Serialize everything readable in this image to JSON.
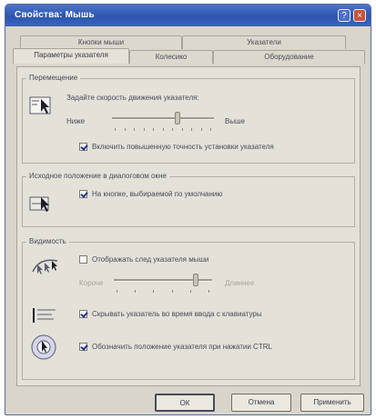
{
  "window": {
    "title": "Свойства: Мышь",
    "help_label": "?",
    "close_label": "×"
  },
  "tabs": {
    "row1": [
      {
        "label": "Кнопки мыши"
      },
      {
        "label": "Указатели"
      }
    ],
    "row2": [
      {
        "label": "Параметры указателя",
        "active": true
      },
      {
        "label": "Колесико"
      },
      {
        "label": "Оборудование"
      }
    ]
  },
  "motion": {
    "title": "Перемещение",
    "prompt": "Задайте скорость движения указателя:",
    "low_label": "Ниже",
    "high_label": "Выше",
    "speed_level": 0.65,
    "precision_label": "Включить повышенную точность установки указателя",
    "precision_checked": true
  },
  "snap": {
    "title": "Исходное положение в диалоговом окне",
    "label": "На кнопке, выбираемой по умолчанию",
    "checked": true
  },
  "visibility": {
    "title": "Видимость",
    "trails_label": "Отображать след указателя мыши",
    "trails_checked": false,
    "short_label": "Короче",
    "long_label": "Длиннее",
    "trails_level": 0.85,
    "hide_label": "Скрывать указатель во время ввода с клавиатуры",
    "hide_checked": true,
    "ctrl_label": "Обозначить положение указателя при нажатии CTRL",
    "ctrl_checked": true
  },
  "buttons": {
    "ok": "ОК",
    "cancel": "Отмена",
    "apply": "Применить"
  },
  "colors": {
    "titlebar": "#2d55b0",
    "dialog_bg": "#d9d5ca",
    "check_mark": "#27308a"
  }
}
